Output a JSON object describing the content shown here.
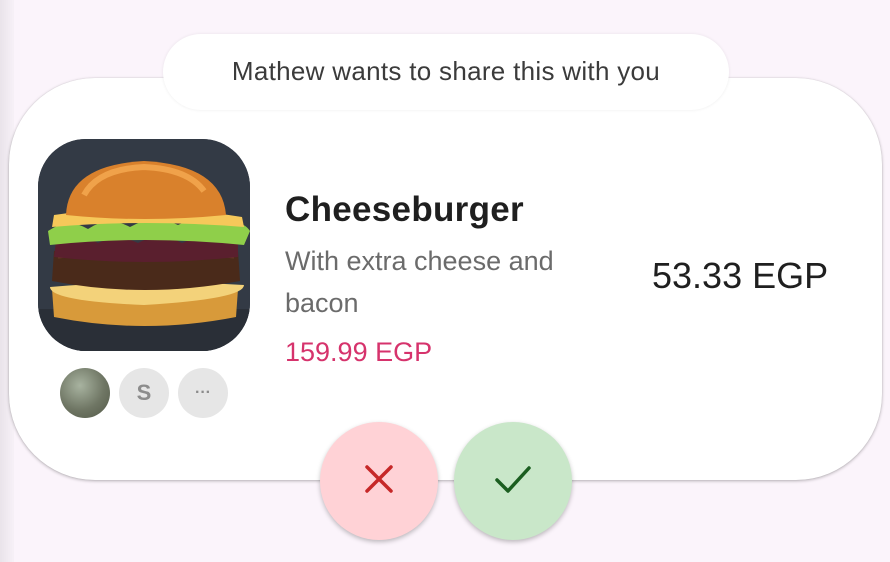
{
  "share": {
    "message": "Mathew wants to share this with you"
  },
  "product": {
    "name": "Cheeseburger",
    "description": "With extra cheese and bacon",
    "original_price": "159.99 EGP",
    "shared_price": "53.33 EGP",
    "image": "cheeseburger-photo"
  },
  "participants": [
    {
      "type": "photo",
      "label": ""
    },
    {
      "type": "initial",
      "label": "S"
    },
    {
      "type": "more",
      "label": "···"
    }
  ],
  "actions": {
    "decline_icon": "close-icon",
    "accept_icon": "check-icon"
  },
  "colors": {
    "price_accent": "#d6336c",
    "decline_bg": "#ffd2d6",
    "decline_icon": "#c62828",
    "accept_bg": "#c9e7c9",
    "accept_icon": "#1b5e20"
  }
}
